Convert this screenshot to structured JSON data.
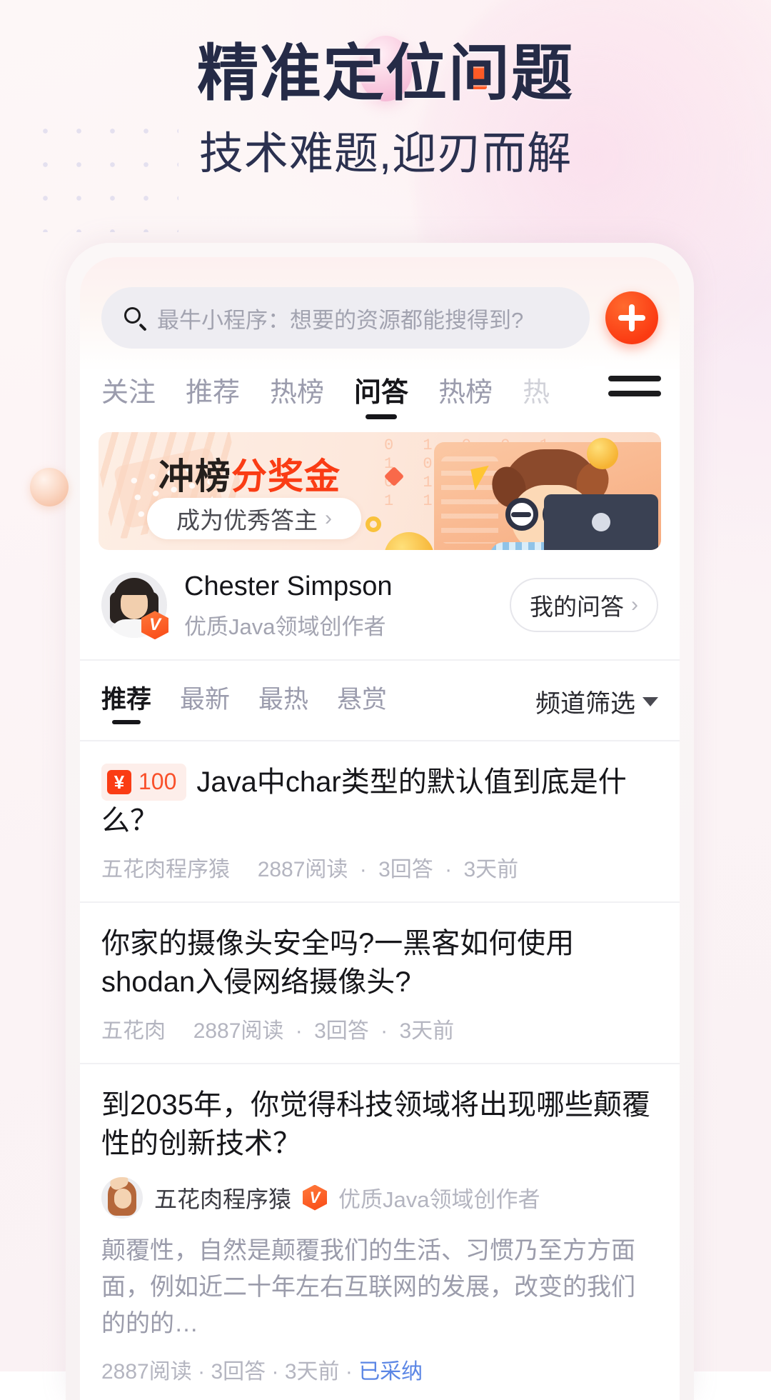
{
  "promo": {
    "headline_pre": "精准定位",
    "headline_accent": "问",
    "headline_post": "题",
    "subheadline": "技术难题,迎刃而解",
    "accent_color": "#ff5a25",
    "text_color": "#252b47"
  },
  "search": {
    "placeholder": "最牛小程序：想要的资源都能搜得到?",
    "icon": "search-icon",
    "add_button_icon": "plus-icon"
  },
  "tabs": {
    "items": [
      {
        "label": "关注",
        "active": false
      },
      {
        "label": "推荐",
        "active": false
      },
      {
        "label": "热榜",
        "active": false
      },
      {
        "label": "问答",
        "active": true
      },
      {
        "label": "热榜",
        "active": false
      },
      {
        "label": "热",
        "active": false
      }
    ],
    "menu_icon": "hamburger-menu-icon"
  },
  "banner": {
    "title_dark": "冲榜",
    "title_accent": "分奖金",
    "cta_label": "成为优秀答主",
    "cta_chevron": "›",
    "accent_color": "#fa3c14",
    "binary_decor": "0 1 0 0 1\n1 0 1 1 0\n0 1 0 0 1\n1 1 0 1 0"
  },
  "profile": {
    "name": "Chester Simpson",
    "subtitle": "优质Java领域创作者",
    "verified_badge": "V",
    "my_qa_label": "我的问答",
    "my_qa_chevron": "›"
  },
  "subtabs": {
    "items": [
      {
        "label": "推荐",
        "active": true
      },
      {
        "label": "最新",
        "active": false
      },
      {
        "label": "最热",
        "active": false
      },
      {
        "label": "悬赏",
        "active": false
      }
    ],
    "filter_label": "频道筛选",
    "filter_icon": "chevron-down-icon"
  },
  "questions": [
    {
      "bounty_currency": "¥",
      "bounty_amount": "100",
      "title": "Java中char类型的默认值到底是什么？",
      "author": "五花肉程序猿",
      "views": "2887阅读",
      "answers": "3回答",
      "time": "3天前"
    },
    {
      "title": "你家的摄像头安全吗?一黑客如何使用shodan入侵网络摄像头?",
      "author": "五花肉",
      "views": "2887阅读",
      "answers": "3回答",
      "time": "3天前"
    },
    {
      "title": "到2035年，你觉得科技领域将出现哪些颠覆性的创新技术？",
      "author": "五花肉程序猿",
      "author_badge": "V",
      "author_badge_text": "优质Java领域创作者",
      "description": "颠覆性，自然是颠覆我们的生活、习惯乃至方方面面，例如近二十年左右互联网的发展，改变的我们的的的…",
      "views": "2887阅读",
      "answers": "3回答",
      "time": "3天前",
      "status": "已采纳",
      "status_color": "#5b86e5"
    }
  ]
}
